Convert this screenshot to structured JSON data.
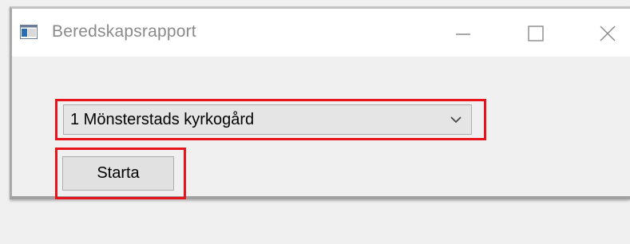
{
  "window": {
    "title": "Beredskapsrapport",
    "icons": {
      "app": "app-window-icon",
      "minimize": "minimize-icon",
      "maximize": "maximize-icon",
      "close": "close-icon"
    }
  },
  "form": {
    "location_select": {
      "selected_value": "1 Mönsterstads kyrkogård",
      "icon": "chevron-down-icon"
    },
    "start_button_label": "Starta"
  },
  "colors": {
    "highlight": "#e8141b",
    "title_text": "#8a8a8a",
    "window_bg": "#f0f0f0"
  }
}
